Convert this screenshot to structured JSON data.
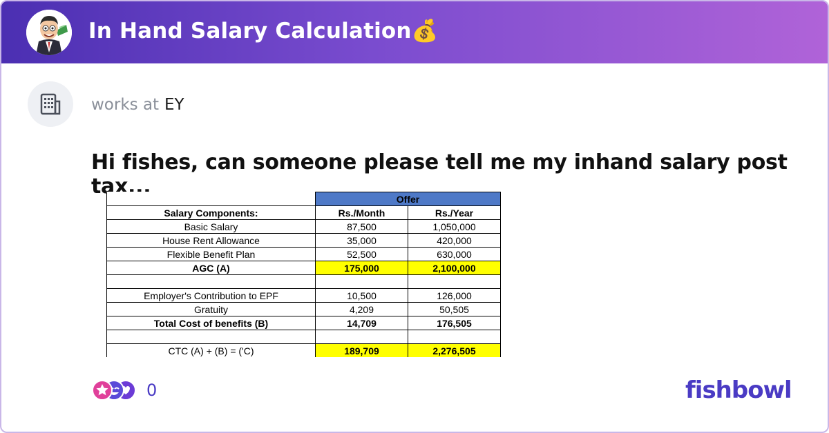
{
  "header": {
    "title": "In Hand Salary Calculation💰",
    "bowl_icon": "cartoon-businessman-avatar"
  },
  "author": {
    "company_icon": "building-icon",
    "works_at_label": "works at",
    "company": "EY"
  },
  "post": {
    "title": "Hi fishes, can someone please tell me my inhand salary post tax..."
  },
  "salary_table": {
    "group_header": "Offer",
    "columns": [
      "Salary Components:",
      "Rs./Month",
      "Rs./Year"
    ],
    "rows": [
      [
        "Basic Salary",
        "87,500",
        "1,050,000"
      ],
      [
        "House Rent Allowance",
        "35,000",
        "420,000"
      ],
      [
        "Flexible Benefit Plan",
        "52,500",
        "630,000"
      ],
      [
        "AGC (A)",
        "175,000",
        "2,100,000"
      ],
      [
        "",
        "",
        ""
      ],
      [
        "Employer's Contribution to EPF",
        "10,500",
        "126,000"
      ],
      [
        "Gratuity",
        "4,209",
        "50,505"
      ],
      [
        "Total Cost of benefits (B)",
        "14,709",
        "176,505"
      ],
      [
        "",
        "",
        ""
      ],
      [
        "CTC (A) + (B) = ('C)",
        "189,709",
        "2,276,505"
      ]
    ]
  },
  "footer": {
    "reaction_icons": [
      "star-reaction-icon",
      "laugh-reaction-icon",
      "heart-reaction-icon"
    ],
    "reaction_count": "0",
    "brand": "fishbowl"
  },
  "colors": {
    "header_gradient_start": "#4b2fb2",
    "header_gradient_end": "#b063d8",
    "brand": "#4a3bc4",
    "highlight": "#ffff00",
    "offer_header": "#4e79c7"
  }
}
